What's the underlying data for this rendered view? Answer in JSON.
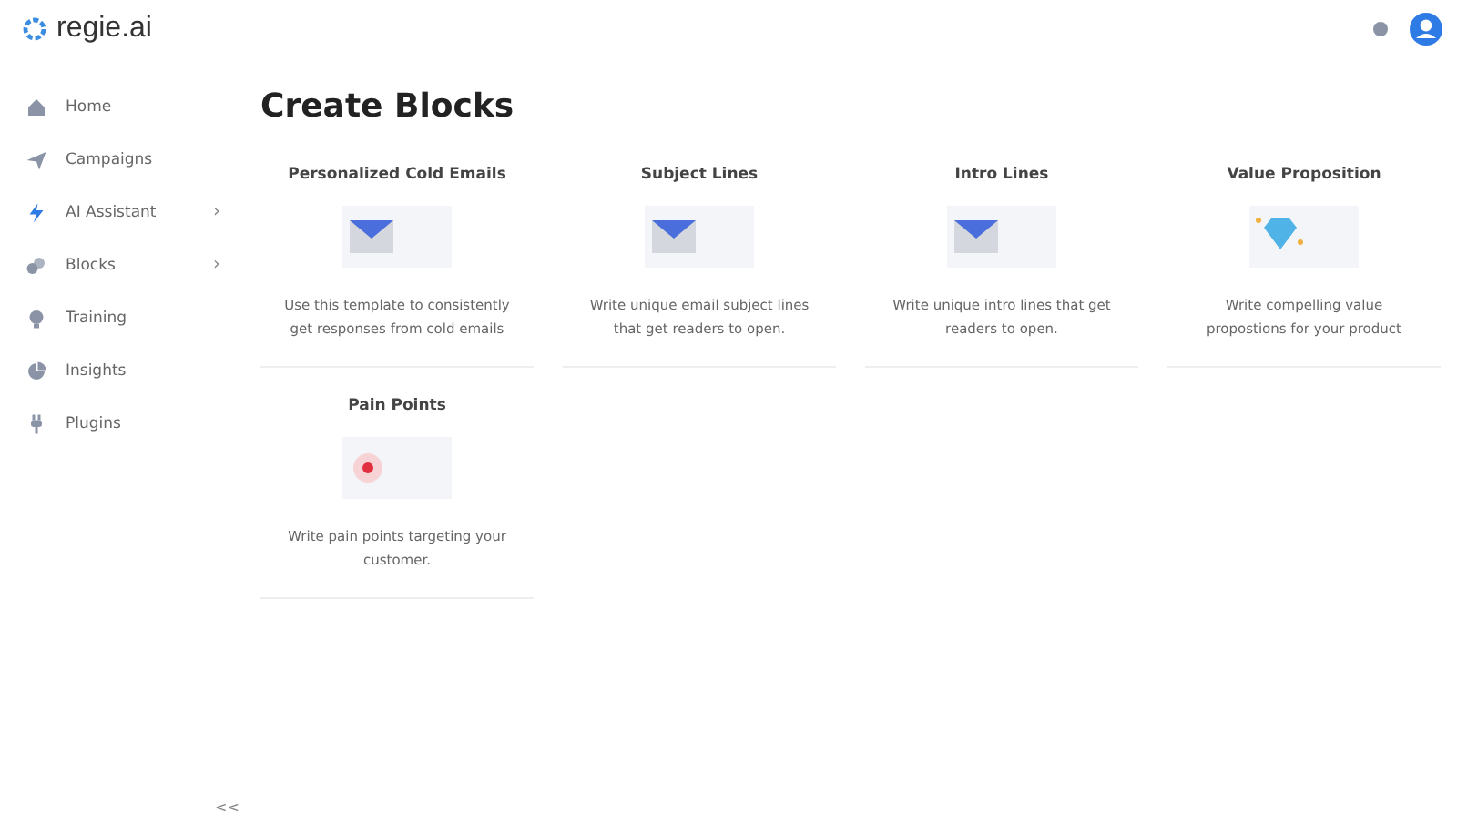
{
  "header": {
    "logo_text": "regie.ai"
  },
  "sidebar": {
    "items": [
      {
        "label": "Home"
      },
      {
        "label": "Campaigns"
      },
      {
        "label": "AI Assistant",
        "chevron": "›"
      },
      {
        "label": "Blocks",
        "chevron": "›"
      },
      {
        "label": "Training"
      },
      {
        "label": "Insights"
      },
      {
        "label": "Plugins"
      }
    ],
    "collapse": "<<"
  },
  "page_title": "Create Blocks",
  "cards": [
    {
      "title": "Personalized Cold Emails",
      "kind": "envelope",
      "description": "Use this template to consistently get responses from cold emails"
    },
    {
      "title": "Subject Lines",
      "kind": "envelope",
      "description": "Write unique email subject lines that get readers to open."
    },
    {
      "title": "Intro Lines",
      "kind": "envelope",
      "description": "Write unique intro lines that get readers to open."
    },
    {
      "title": "Value Proposition",
      "kind": "diamond",
      "description": "Write compelling value propostions for your product"
    },
    {
      "title": "Pain Points",
      "kind": "target",
      "description": "Write pain points targeting your customer."
    }
  ]
}
